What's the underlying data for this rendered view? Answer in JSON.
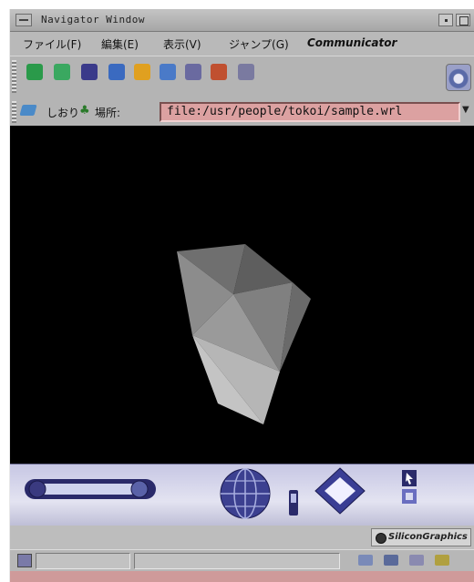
{
  "window": {
    "title": "Navigator Window"
  },
  "menu": {
    "file": "ファイル(F)",
    "edit": "編集(E)",
    "view": "表示(V)",
    "go": "ジャンプ(G)",
    "communicator": "Communicator"
  },
  "toolbar": {
    "buttons": [
      "back-icon",
      "forward-icon",
      "reload-icon",
      "home-icon",
      "search-icon",
      "netscape-icon",
      "print-icon",
      "security-icon",
      "stop-icon"
    ],
    "colors": [
      "#2a9a4a",
      "#3aa860",
      "#3a3a8a",
      "#3a6ac0",
      "#e0a020",
      "#4a7ac8",
      "#6a6aa0",
      "#c05030",
      "#7a7aa0"
    ]
  },
  "location": {
    "bookmarks_label": "しおり",
    "location_label": "場所:",
    "url": "file:/usr/people/tokoi/sample.wrl"
  },
  "viewer": {
    "background_color": "#000000",
    "object_color": "#8a8a8a"
  },
  "dashboard": {
    "controls": [
      "walk-slider-icon",
      "examine-globe-icon",
      "zoom-icon",
      "pan-diamond-icon",
      "select-pointer-icon"
    ]
  },
  "status": {
    "brand": "SiliconGraphics"
  }
}
